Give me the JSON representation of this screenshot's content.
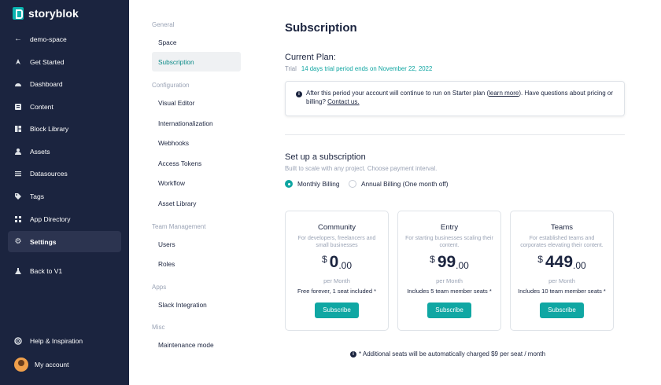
{
  "brand": {
    "name": "storyblok",
    "accent": "#09b3af",
    "sidebar_bg": "#1b243f"
  },
  "sidebar": {
    "back": {
      "label": "demo-space",
      "icon": "arrow-left-icon"
    },
    "items": [
      {
        "label": "Get Started",
        "icon": "rocket-icon"
      },
      {
        "label": "Dashboard",
        "icon": "dashboard-icon"
      },
      {
        "label": "Content",
        "icon": "content-icon"
      },
      {
        "label": "Block Library",
        "icon": "blocks-icon"
      },
      {
        "label": "Assets",
        "icon": "assets-icon"
      },
      {
        "label": "Datasources",
        "icon": "list-icon"
      },
      {
        "label": "Tags",
        "icon": "tag-icon"
      },
      {
        "label": "App Directory",
        "icon": "apps-icon"
      },
      {
        "label": "Settings",
        "icon": "gear-icon"
      },
      {
        "label": "Back to V1",
        "icon": "flask-icon"
      }
    ],
    "bottom": [
      {
        "label": "Help & Inspiration",
        "icon": "help-icon"
      },
      {
        "label": "My account",
        "icon": "avatar"
      }
    ]
  },
  "subnav": {
    "groups": [
      {
        "label": "General",
        "items": [
          "Space",
          "Subscription"
        ]
      },
      {
        "label": "Configuration",
        "items": [
          "Visual Editor",
          "Internationalization",
          "Webhooks",
          "Access Tokens",
          "Workflow",
          "Asset Library"
        ]
      },
      {
        "label": "Team Management",
        "items": [
          "Users",
          "Roles"
        ]
      },
      {
        "label": "Apps",
        "items": [
          "Slack Integration"
        ]
      },
      {
        "label": "Misc",
        "items": [
          "Maintenance mode"
        ]
      }
    ],
    "active": "Subscription"
  },
  "main": {
    "title": "Subscription",
    "current_plan_label": "Current Plan:",
    "plan_name": "Trial",
    "plan_status": "14 days trial period ends on November 22, 2022",
    "notice": {
      "text_before": "After this period your account will continue to run on Starter plan (",
      "learn_more": "learn more",
      "text_mid": "). Have questions about pricing or billing? ",
      "contact": "Contact us."
    },
    "setup_title": "Set up a subscription",
    "setup_sub": "Built to scale with any project. Choose payment interval.",
    "billing": [
      {
        "label": "Monthly Billing",
        "selected": true
      },
      {
        "label": "Annual Billing (One month off)",
        "selected": false
      }
    ],
    "plans": [
      {
        "name": "Community",
        "desc": "For developers, freelancers and small businesses",
        "currency": "$",
        "amount": "0",
        "cents": ".00",
        "period": "per Month",
        "includes": "Free forever, 1 seat included *",
        "cta": "Subscribe"
      },
      {
        "name": "Entry",
        "desc": "For starting businesses scaling their content.",
        "currency": "$",
        "amount": "99",
        "cents": ".00",
        "period": "per Month",
        "includes": "Includes 5 team member seats *",
        "cta": "Subscribe"
      },
      {
        "name": "Teams",
        "desc": "For established teams and corporates elevating their content.",
        "currency": "$",
        "amount": "449",
        "cents": ".00",
        "period": "per Month",
        "includes": "Includes 10 team member seats *",
        "cta": "Subscribe"
      }
    ],
    "footnote": "* Additional seats will be automatically charged $9 per seat / month"
  }
}
